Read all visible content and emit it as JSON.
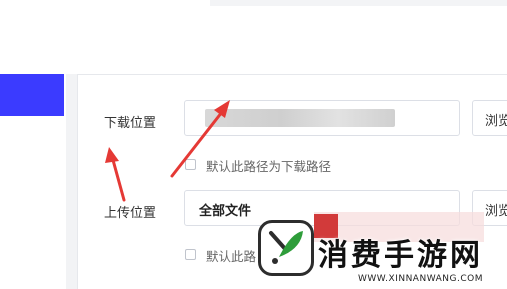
{
  "settings": {
    "download": {
      "label": "下载位置",
      "path": "",
      "browse": "浏览",
      "checkbox": "默认此路径为下载路径"
    },
    "upload": {
      "label": "上传位置",
      "value": "全部文件",
      "browse": "浏览",
      "checkbox": "默认此路"
    }
  },
  "watermark": {
    "title": "消费手游网",
    "url": "WWW.XINNANWANG.COM"
  },
  "colors": {
    "accent": "#3b3bff",
    "arrow": "#e53935",
    "logo_green": "#2e9d3a"
  }
}
